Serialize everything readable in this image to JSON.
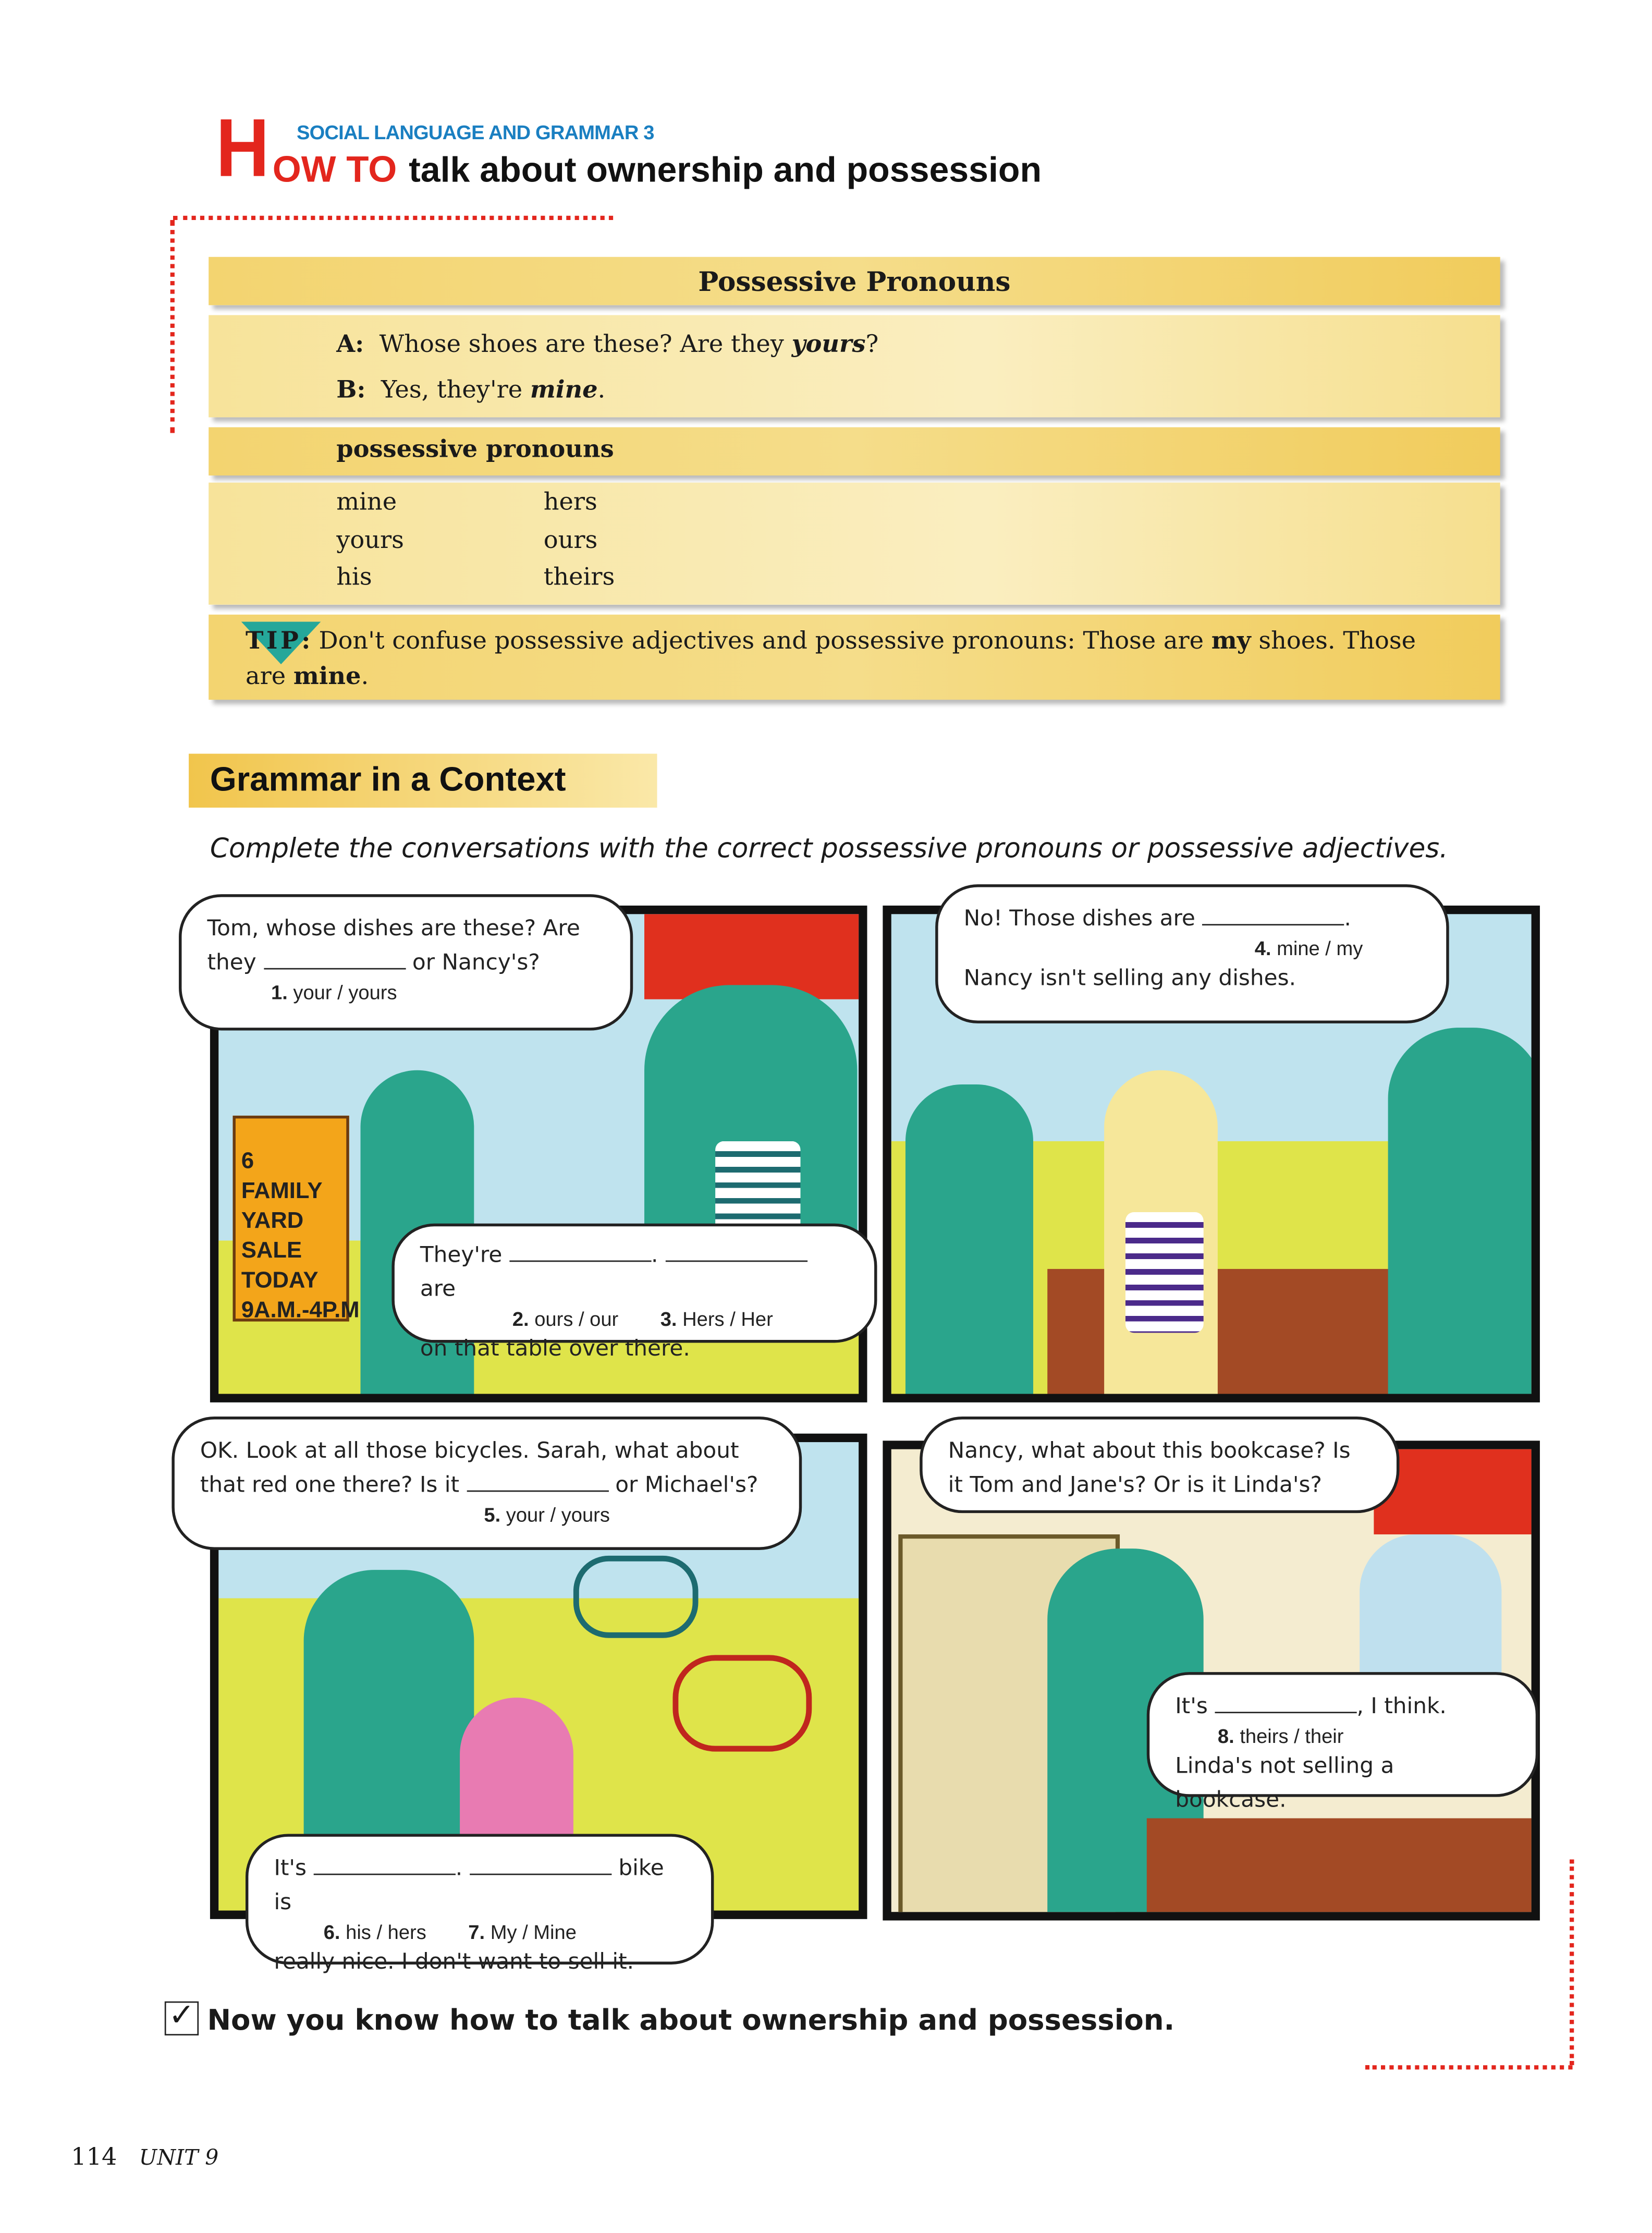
{
  "header": {
    "kicker": "SOCIAL LANGUAGE AND GRAMMAR 3",
    "big_letter": "H",
    "how_to": "OW TO",
    "title": "talk about ownership and possession"
  },
  "grammar_box": {
    "heading": "Possessive Pronouns",
    "example": [
      {
        "speaker": "A:",
        "text": "Whose shoes are these? Are they ",
        "emph": "yours",
        "end": "?"
      },
      {
        "speaker": "B:",
        "text": "Yes, they're ",
        "emph": "mine",
        "end": "."
      }
    ],
    "list_heading": "possessive pronouns",
    "col1": [
      "mine",
      "yours",
      "his"
    ],
    "col2": [
      "hers",
      "ours",
      "theirs"
    ],
    "tip_label": "TIP",
    "tip": {
      "a": "Don't confuse possessive adjectives and possessive pronouns: Those are ",
      "b": "my",
      "c": " shoes. Those are ",
      "d": "mine",
      "e": "."
    }
  },
  "context": {
    "heading": "Grammar in a Context",
    "instruction": "Complete the conversations with the correct possessive pronouns or possessive adjectives."
  },
  "panels": {
    "p1": {
      "sign": [
        "6 FAMILY",
        "YARD SALE",
        "TODAY",
        "9A.M.-4P.M."
      ],
      "b1": {
        "l1": "Tom, whose dishes are these? Are",
        "l2a": "they",
        "l2b": "or Nancy's?",
        "num": "1.",
        "opt": "your / yours"
      },
      "b2": {
        "l1a": "They're",
        "l1b": ".",
        "l1c": "are",
        "n2": "2.",
        "o2": "ours / our",
        "n3": "3.",
        "o3": "Hers / Her",
        "l3": "on that table over there."
      }
    },
    "p2": {
      "b1": {
        "l1": "No! Those dishes are",
        "end": ".",
        "num": "4.",
        "opt": "mine / my",
        "l3": "Nancy isn't selling any dishes."
      }
    },
    "p3": {
      "b1": {
        "l1": "OK. Look at all those bicycles. Sarah, what about",
        "l2a": "that red one there? Is it",
        "l2b": "or Michael's?",
        "num": "5.",
        "opt": "your / yours"
      },
      "b2": {
        "l1a": "It's",
        "l1b": ".",
        "l1c": "bike is",
        "n6": "6.",
        "o6": "his / hers",
        "n7": "7.",
        "o7": "My / Mine",
        "l3": "really nice. I don't want to sell it."
      }
    },
    "p4": {
      "b1": {
        "l1": "Nancy, what about this bookcase? Is",
        "l2": "it Tom and Jane's? Or is it Linda's?"
      },
      "b2": {
        "l1a": "It's",
        "l1b": ", I think.",
        "num": "8.",
        "opt": "theirs / their",
        "l3": "Linda's not selling a bookcase."
      }
    }
  },
  "footer": {
    "checkmark": "✓",
    "summary": "Now you know how to talk about ownership and possession.",
    "page_number": "114",
    "unit": "UNIT 9"
  },
  "colors": {
    "accent_red": "#e3261d",
    "kicker_blue": "#1a7fc1",
    "box_yellow": "#f5dd8a",
    "tip_teal": "#25a79a"
  }
}
